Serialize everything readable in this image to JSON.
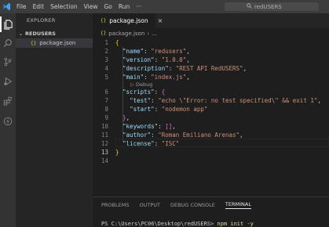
{
  "titlebar": {
    "menu": [
      "File",
      "Edit",
      "Selection",
      "View",
      "Go",
      "Run",
      "···"
    ],
    "search_text": "redUSERS"
  },
  "sidebar": {
    "header": "EXPLORER",
    "folder": "REDUSERS",
    "file": "package.json"
  },
  "tab": {
    "label": "package.json",
    "close": "×"
  },
  "breadcrumb": {
    "file": "package.json",
    "sep": "›",
    "node": "..."
  },
  "editor": {
    "codelens": "Debug",
    "lines": [
      {
        "n": "1"
      },
      {
        "n": "2"
      },
      {
        "n": "3"
      },
      {
        "n": "4"
      },
      {
        "n": "5"
      },
      {
        "n": "6"
      },
      {
        "n": "7"
      },
      {
        "n": "8"
      },
      {
        "n": "9"
      },
      {
        "n": "10"
      },
      {
        "n": "11"
      },
      {
        "n": "12"
      },
      {
        "n": "13"
      },
      {
        "n": "14"
      }
    ],
    "keys": {
      "name": "\"name\"",
      "version": "\"version\"",
      "description": "\"description\"",
      "main": "\"main\"",
      "scripts": "\"scripts\"",
      "test": "\"test\"",
      "start": "\"start\"",
      "keywords": "\"keywords\"",
      "author": "\"author\"",
      "license": "\"license\""
    },
    "values": {
      "name": "\"redusers\"",
      "version": "\"1.0.0\"",
      "description": "\"REST API RedUSERS\"",
      "main": "\"index.js\"",
      "test": "\"echo \\\"Error: no test specified\\\" && exit 1\"",
      "start": "\"nodemon app\"",
      "author": "\"Roman Emiliano Arenas\"",
      "license": "\"ISC\""
    }
  },
  "panel": {
    "tabs": [
      "PROBLEMS",
      "OUTPUT",
      "DEBUG CONSOLE",
      "TERMINAL"
    ],
    "prompt": "PS C:\\Users\\PC06\\Desktop\\redUSERS> ",
    "command": "npm init -y"
  },
  "colors": {
    "activity_bg": "#333333",
    "editor_bg": "#1e1e1e",
    "sidebar_bg": "#252526",
    "titlebar_bg": "#3c3c3c"
  }
}
